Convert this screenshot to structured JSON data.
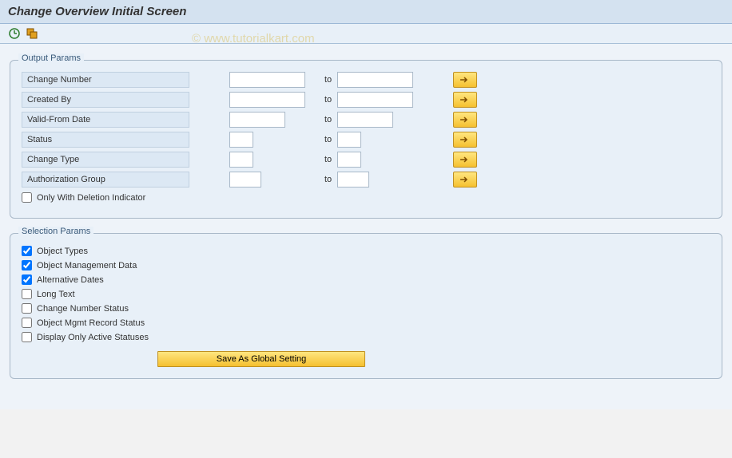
{
  "header": {
    "title": "Change Overview Initial Screen"
  },
  "watermark": "© www.tutorialkart.com",
  "output_group": {
    "title": "Output Params",
    "rows": [
      {
        "label": "Change Number",
        "width": "med",
        "to": "to"
      },
      {
        "label": "Created By",
        "width": "med",
        "to": "to"
      },
      {
        "label": "Valid-From Date",
        "width": "medshort",
        "to": "to"
      },
      {
        "label": "Status",
        "width": "short",
        "to": "to"
      },
      {
        "label": "Change Type",
        "width": "short",
        "to": "to"
      },
      {
        "label": "Authorization Group",
        "width": "short",
        "to": "to"
      }
    ],
    "deletion_checkbox": "Only With Deletion Indicator"
  },
  "selection_group": {
    "title": "Selection Params",
    "checkboxes": [
      {
        "label": "Object Types",
        "checked": true
      },
      {
        "label": "Object Management Data",
        "checked": true
      },
      {
        "label": "Alternative Dates",
        "checked": true
      },
      {
        "label": "Long Text",
        "checked": false
      },
      {
        "label": "Change Number Status",
        "checked": false
      },
      {
        "label": "Object Mgmt Record Status",
        "checked": false
      },
      {
        "label": "Display Only Active Statuses",
        "checked": false
      }
    ],
    "save_button": "Save As Global Setting"
  }
}
